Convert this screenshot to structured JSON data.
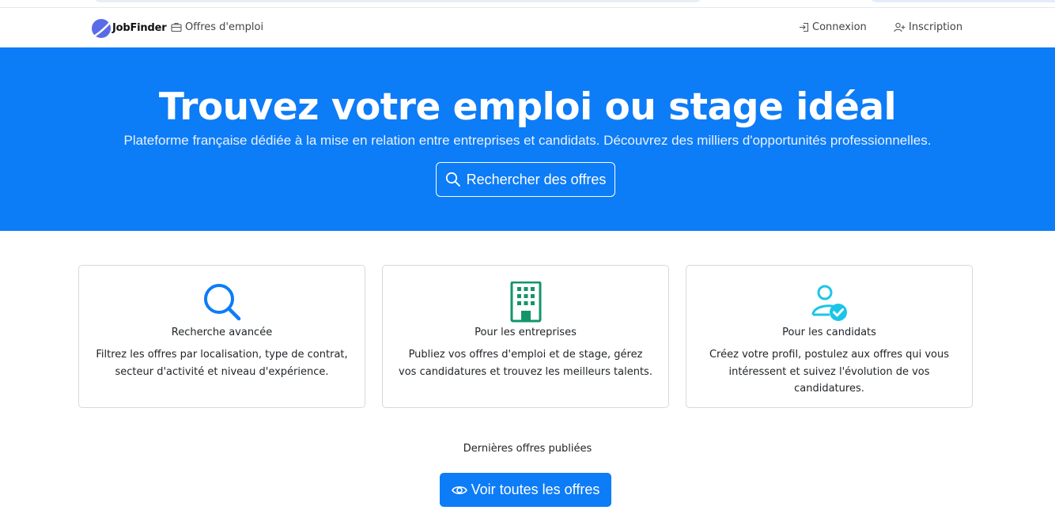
{
  "navbar": {
    "brand": "JobFinder",
    "jobs_link": "Offres d'emploi",
    "login": "Connexion",
    "signup": "Inscription"
  },
  "hero": {
    "title": "Trouvez votre emploi ou stage idéal",
    "subtitle": "Plateforme française dédiée à la mise en relation entre entreprises et candidats. Découvrez des milliers d'opportunités professionnelles.",
    "search_button": "Rechercher des offres"
  },
  "features": [
    {
      "icon": "magnifier-icon",
      "title": "Recherche avancée",
      "description": "Filtrez les offres par localisation, type de contrat, secteur d'activité et niveau d'expérience."
    },
    {
      "icon": "building-icon",
      "title": "Pour les entreprises",
      "description": "Publiez vos offres d'emploi et de stage, gérez vos candidatures et trouvez les meilleurs talents."
    },
    {
      "icon": "person-check-icon",
      "title": "Pour les candidats",
      "description": "Créez votre profil, postulez aux offres qui vous intéressent et suivez l'évolution de vos candidatures."
    }
  ],
  "latest": {
    "heading": "Dernières offres publiées",
    "view_all_button": "Voir toutes les offres"
  },
  "colors": {
    "primary": "#0d7cf7",
    "success": "#13956a",
    "info": "#1bc5e8"
  }
}
